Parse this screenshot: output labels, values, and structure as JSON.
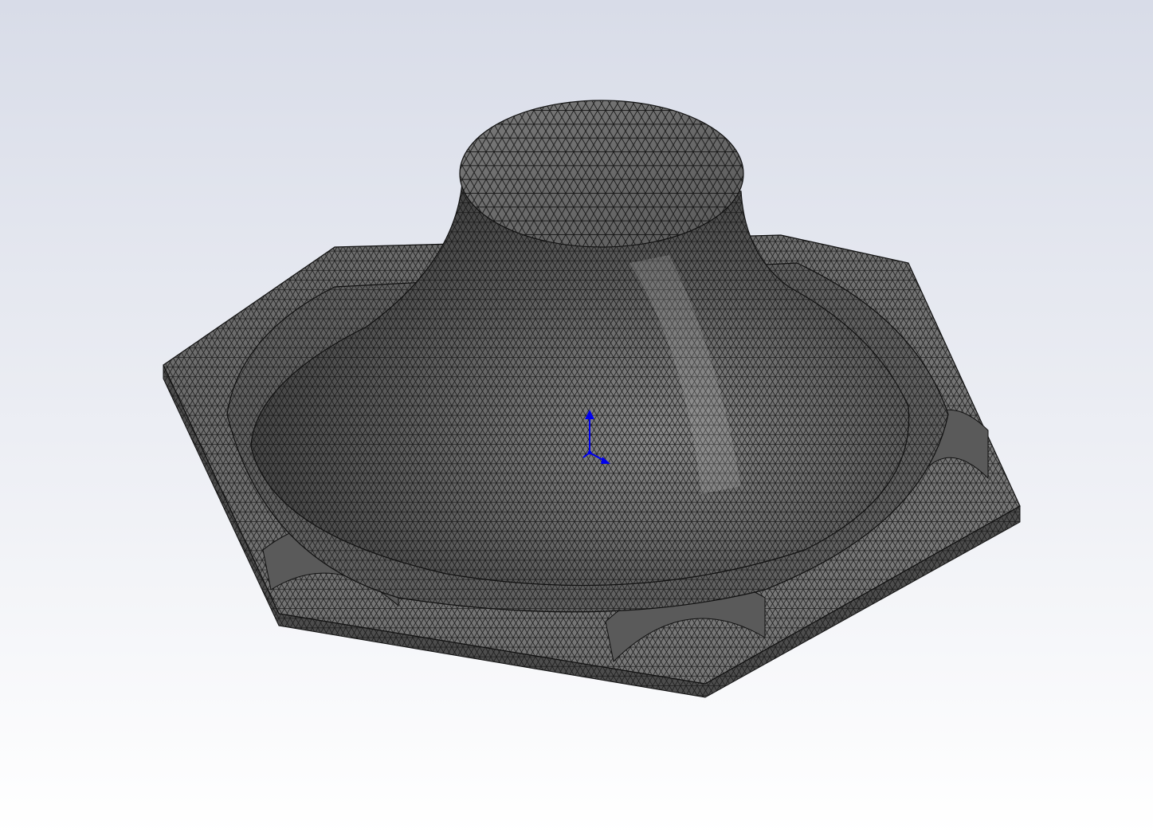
{
  "viewport": {
    "background_top": "#d8dce8",
    "background_bottom": "#ffffff"
  },
  "model": {
    "body_color": "#6e6e6e",
    "top_color": "#7a7a7a",
    "side_color": "#555555",
    "highlight_color": "#9a9a9a",
    "mesh_line_color": "#111111",
    "shape": "hexagonal base with conical dome"
  },
  "triad": {
    "axis_color": "#0000ee",
    "icon": "coordinate-triad-icon"
  }
}
